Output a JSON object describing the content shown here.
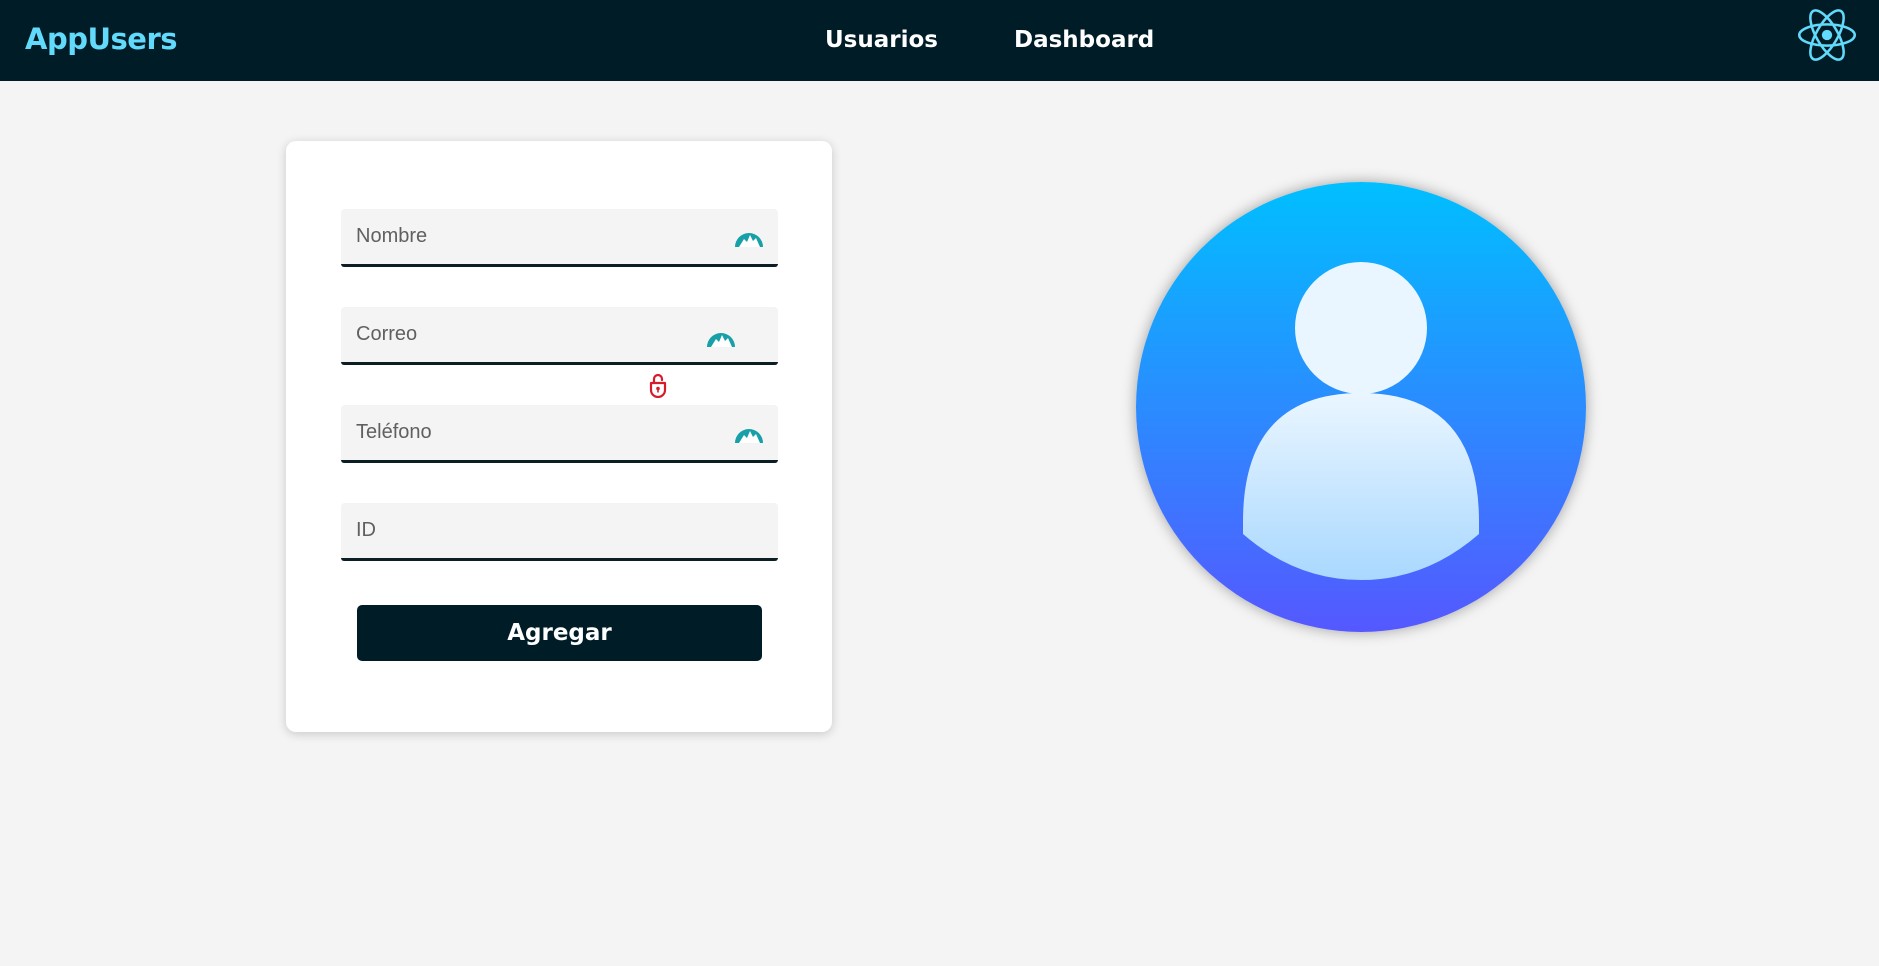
{
  "navbar": {
    "brand": "AppUsers",
    "links": [
      {
        "label": "Usuarios"
      },
      {
        "label": "Dashboard"
      }
    ],
    "logo_icon": "react-logo-icon"
  },
  "form": {
    "fields": [
      {
        "placeholder": "Nombre",
        "value": ""
      },
      {
        "placeholder": "Correo",
        "value": ""
      },
      {
        "placeholder": "Teléfono",
        "value": ""
      },
      {
        "placeholder": "ID",
        "value": ""
      }
    ],
    "submit_label": "Agregar"
  },
  "avatar": {
    "icon": "user-avatar-icon"
  },
  "colors": {
    "navbar_bg": "#001d27",
    "brand": "#61dafb",
    "button_bg": "#001d27",
    "avatar_gradient_top": "#00bfff",
    "avatar_gradient_bottom": "#5558ff"
  }
}
